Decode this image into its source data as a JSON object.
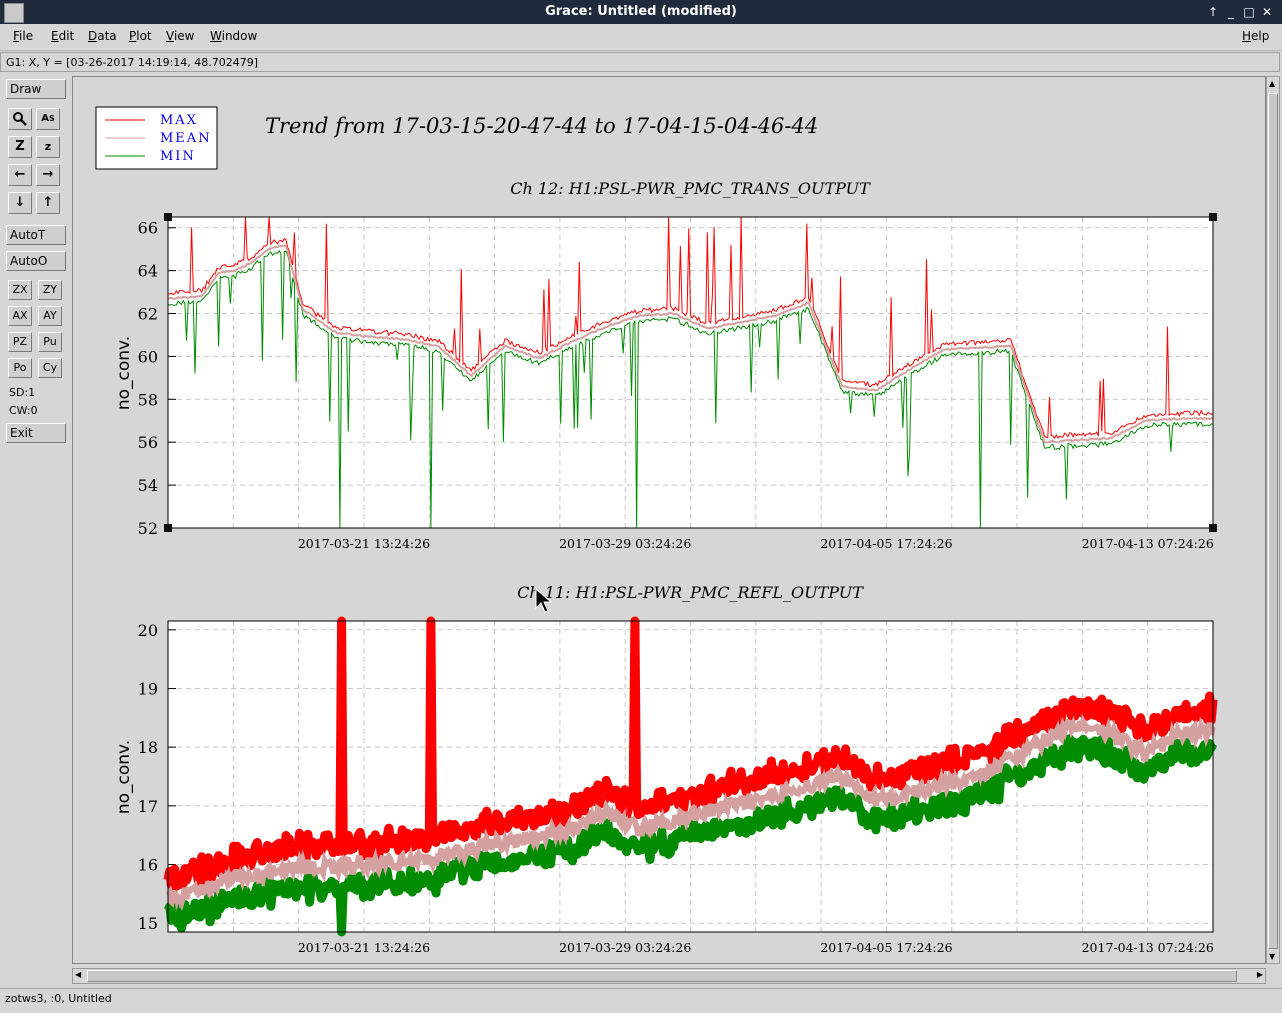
{
  "window": {
    "title": "Grace: Untitled (modified)"
  },
  "menu": [
    {
      "label": "File",
      "mnemonic": "F",
      "rest": "ile"
    },
    {
      "label": "Edit",
      "mnemonic": "E",
      "rest": "dit"
    },
    {
      "label": "Data",
      "mnemonic": "D",
      "rest": "ata"
    },
    {
      "label": "Plot",
      "mnemonic": "P",
      "rest": "lot"
    },
    {
      "label": "View",
      "mnemonic": "V",
      "rest": "iew"
    },
    {
      "label": "Window",
      "mnemonic": "W",
      "rest": "indow"
    },
    {
      "label": "Help",
      "mnemonic": "H",
      "rest": "elp"
    }
  ],
  "locator": "G1: X, Y = [03-26-2017 14:19:14, 48.702479]",
  "toolbar": {
    "draw": "Draw",
    "autot": "AutoT",
    "autoo": "AutoO",
    "zx": "ZX",
    "zy": "ZY",
    "ax": "AX",
    "ay": "AY",
    "pz": "PZ",
    "pu": "Pu",
    "po": "Po",
    "cy": "Cy",
    "sd": "SD:1",
    "cw": "CW:0",
    "exit": "Exit"
  },
  "status": "zotws3, :0, Untitled",
  "colors": {
    "max": "#ff0000",
    "mean": "#d4a0a0",
    "min": "#008c00"
  },
  "chart_data": [
    {
      "type": "line",
      "title": "Ch 12: H1:PSL-PWR_PMC_TRANS_OUTPUT",
      "suptitle": "Trend from 17-03-15-20-47-44 to 17-04-15-04-46-44",
      "ylabel": "no_conv.",
      "ylim": [
        52,
        66.5
      ],
      "yticks": [
        "52",
        "54",
        "56",
        "58",
        "60",
        "62",
        "64",
        "66"
      ],
      "xticks": [
        "2017-03-21 13:24:26",
        "2017-03-29 03:24:26",
        "2017-04-05 17:24:26",
        "2017-04-13 07:24:26"
      ],
      "legend": [
        "MAX",
        "MEAN",
        "MIN"
      ],
      "legend_position": "top-left",
      "grid": true,
      "x": [
        0,
        1,
        1.5,
        2,
        2.5,
        3,
        3.5,
        4,
        5,
        6,
        7,
        8,
        9,
        10,
        11,
        12,
        13,
        14,
        15,
        16,
        17,
        18,
        19,
        20,
        21,
        22,
        23,
        24,
        25,
        26,
        27,
        28,
        29,
        30,
        31
      ],
      "series": [
        {
          "name": "MEAN",
          "values": [
            62.7,
            62.8,
            63.9,
            64.0,
            64.4,
            65.0,
            65.2,
            62.2,
            61.1,
            60.9,
            60.8,
            60.5,
            59.1,
            60.5,
            59.9,
            60.7,
            61.4,
            61.9,
            62.0,
            61.3,
            61.6,
            61.9,
            62.5,
            58.6,
            58.4,
            59.4,
            60.3,
            60.4,
            60.5,
            56.0,
            56.1,
            56.2,
            57.0,
            57.1,
            57.1
          ]
        }
      ]
    },
    {
      "type": "line",
      "title": "Ch 11: H1:PSL-PWR_PMC_REFL_OUTPUT",
      "ylabel": "no_conv.",
      "ylim": [
        14.85,
        20.15
      ],
      "yticks": [
        "15",
        "16",
        "17",
        "18",
        "19",
        "20"
      ],
      "xticks": [
        "2017-03-21 13:24:26",
        "2017-03-29 03:24:26",
        "2017-04-05 17:24:26",
        "2017-04-13 07:24:26"
      ],
      "grid": true,
      "x": [
        0,
        2,
        4,
        6,
        8,
        10,
        12,
        13,
        14,
        16,
        18,
        20,
        21,
        22,
        24,
        26,
        27,
        28,
        29,
        30,
        31
      ],
      "series": [
        {
          "name": "MEAN",
          "values": [
            15.4,
            15.75,
            15.95,
            16.0,
            16.1,
            16.4,
            16.6,
            16.9,
            16.6,
            16.9,
            17.2,
            17.5,
            17.1,
            17.2,
            17.5,
            18.1,
            18.4,
            18.2,
            17.9,
            18.2,
            18.3
          ]
        }
      ]
    }
  ]
}
